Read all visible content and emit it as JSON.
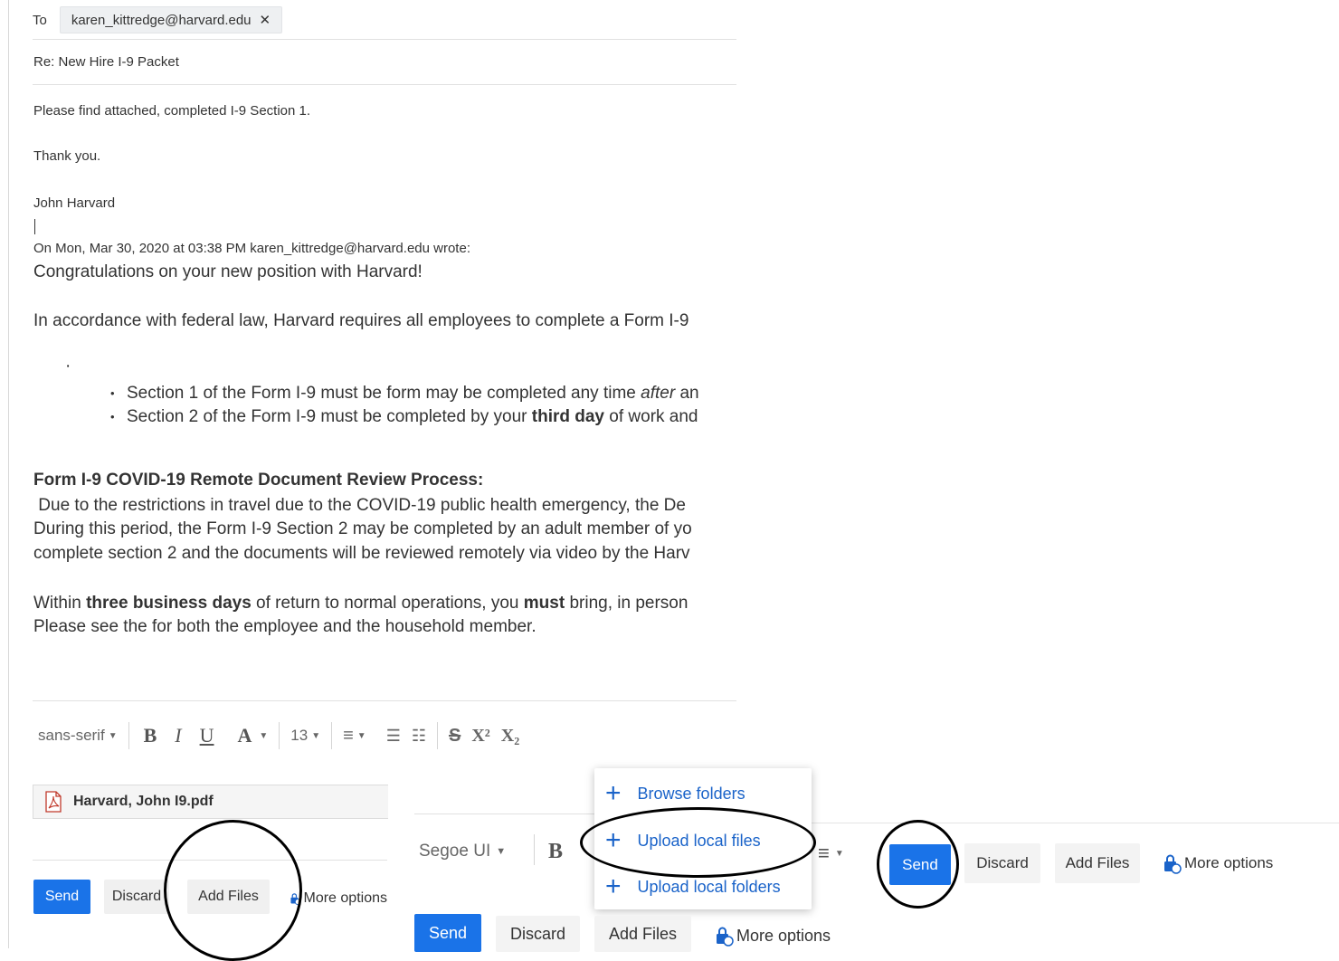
{
  "recipients": {
    "to_label": "To",
    "to_address": "karen_kittredge@harvard.edu",
    "remove_symbol": "✕"
  },
  "subject": "Re: New Hire I-9 Packet",
  "reply_body": {
    "line1": "Please find attached, completed I-9 Section 1.",
    "line2": "Thank you.",
    "signature": "John Harvard"
  },
  "quoted": {
    "header": "On Mon, Mar 30, 2020 at 03:38 PM karen_kittredge@harvard.edu wrote:",
    "greeting": "Congratulations on your new position with Harvard!",
    "para1": "In accordance with federal law, Harvard requires all employees to complete a Form I-9",
    "bullet1": {
      "a": "Section 1 of the Form I-9 must be form may be completed any time ",
      "b": "after",
      "c": " an"
    },
    "bullet2": {
      "a": "Section 2 of the Form I-9 must be completed by your ",
      "b": "third day",
      "c": " of work and"
    },
    "heading": "Form I-9 COVID-19 Remote Document Review Process:",
    "para2_line1": " Due to the restrictions in travel due to the COVID-19 public health emergency, the De",
    "para2_line2": "During this period, the Form I-9 Section 2 may be completed by an adult member of yo",
    "para2_line3": "complete section 2 and the documents will be reviewed remotely via video by the Harv",
    "para3_line1": {
      "a": "Within ",
      "b": "three business days",
      "c": " of return to normal operations, you ",
      "d": "must",
      "e": " bring, in person"
    },
    "para3_line2": "Please see the for both the employee and the household member."
  },
  "toolbar": {
    "font": "sans-serif",
    "bold": "B",
    "italic": "I",
    "underline": "U",
    "color": "A",
    "size": "13",
    "align": "≡",
    "bullets": "☰",
    "numbered": "☷",
    "strike": "S",
    "superscript": "X²",
    "subscript": "X₂"
  },
  "attachment": {
    "name": "Harvard, John I9.pdf"
  },
  "actions": {
    "send": "Send",
    "discard": "Discard",
    "add_files": "Add Files",
    "more": "More options"
  },
  "inset_toolbar": {
    "font": "Segoe UI",
    "bold": "B",
    "align": "≡"
  },
  "add_files_menu": {
    "browse": "Browse folders",
    "upload_files": "Upload local files",
    "upload_folders": "Upload local folders"
  },
  "colors": {
    "accent": "#1a73e8",
    "link": "#1a63c9",
    "annotation": "#000000"
  }
}
